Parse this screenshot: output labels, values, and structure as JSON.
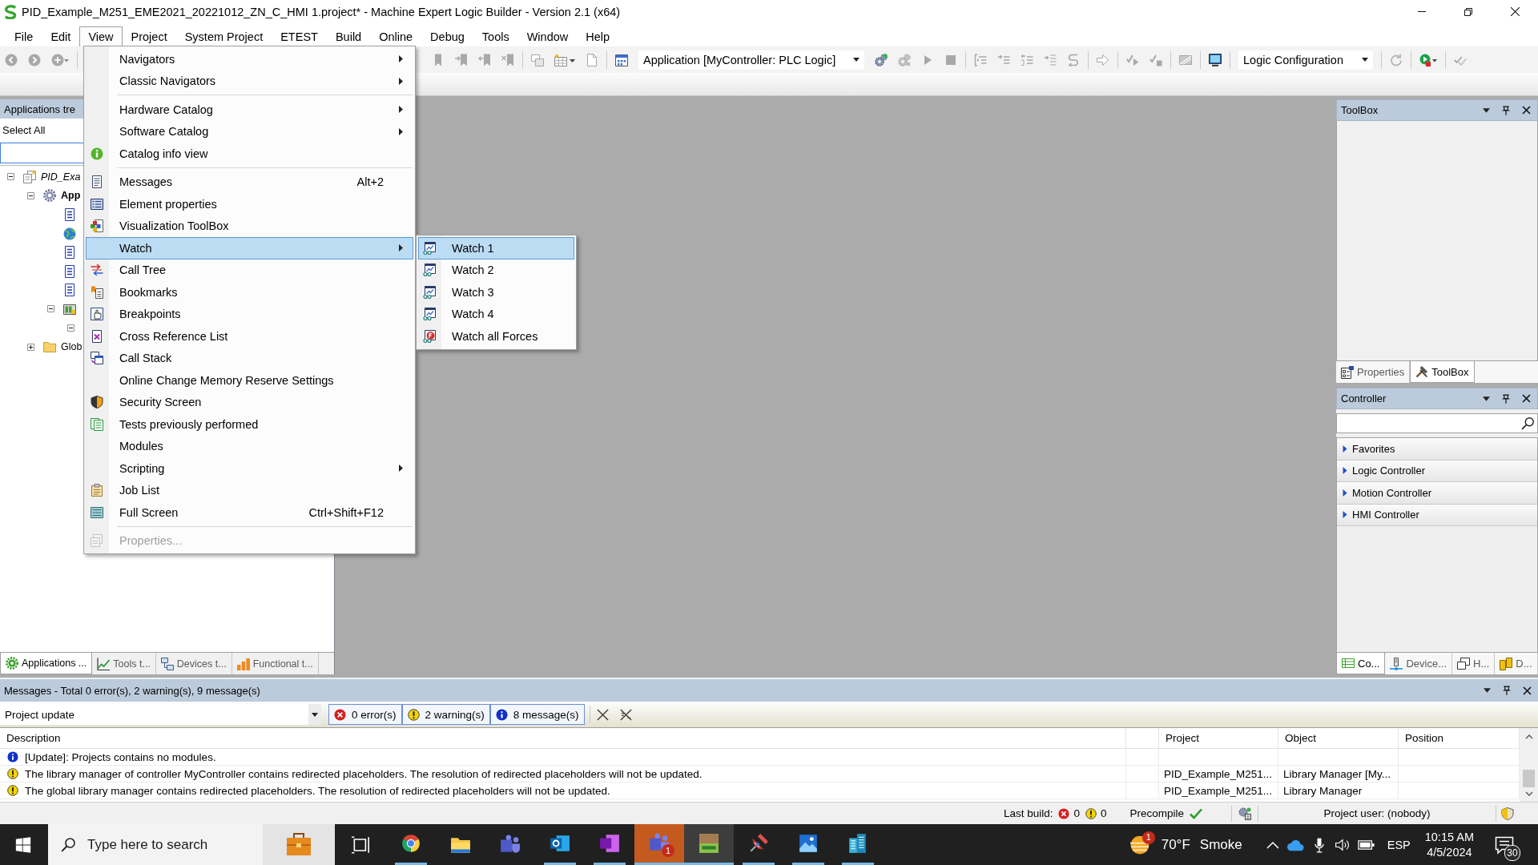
{
  "window": {
    "title": "PID_Example_M251_EME2021_20221012_ZN_C_HMI 1.project* - Machine Expert Logic Builder - Version 2.1 (x64)"
  },
  "menu_bar": [
    {
      "label": "File",
      "selected": false
    },
    {
      "label": "Edit",
      "selected": false
    },
    {
      "label": "View",
      "selected": true
    },
    {
      "label": "Project",
      "selected": false
    },
    {
      "label": "System Project",
      "selected": false
    },
    {
      "label": "ETEST",
      "selected": false
    },
    {
      "label": "Build",
      "selected": false
    },
    {
      "label": "Online",
      "selected": false
    },
    {
      "label": "Debug",
      "selected": false
    },
    {
      "label": "Tools",
      "selected": false
    },
    {
      "label": "Window",
      "selected": false
    },
    {
      "label": "Help",
      "selected": false
    }
  ],
  "toolbar": {
    "application": "Application [MyController: PLC Logic]",
    "configuration": "Logic Configuration"
  },
  "view_menu": [
    {
      "kind": "command",
      "label": "Navigators",
      "submenu": true,
      "selected": false,
      "disabled": false
    },
    {
      "kind": "command",
      "label": "Classic Navigators",
      "submenu": true,
      "selected": false,
      "disabled": false
    },
    {
      "kind": "separator"
    },
    {
      "kind": "command",
      "label": "Hardware Catalog",
      "submenu": true,
      "selected": false,
      "disabled": false
    },
    {
      "kind": "command",
      "label": "Software Catalog",
      "submenu": true,
      "selected": false,
      "disabled": false
    },
    {
      "kind": "command",
      "label": "Catalog info view",
      "submenu": false,
      "selected": false,
      "disabled": false
    },
    {
      "kind": "separator"
    },
    {
      "kind": "command",
      "label": "Messages",
      "shortcut": "Alt+2",
      "submenu": false,
      "selected": false,
      "disabled": false
    },
    {
      "kind": "command",
      "label": "Element properties",
      "submenu": false,
      "selected": false,
      "disabled": false
    },
    {
      "kind": "command",
      "label": "Visualization ToolBox",
      "submenu": false,
      "selected": false,
      "disabled": false
    },
    {
      "kind": "command",
      "label": "Watch",
      "submenu": true,
      "selected": true,
      "disabled": false
    },
    {
      "kind": "command",
      "label": "Call Tree",
      "submenu": false,
      "selected": false,
      "disabled": false
    },
    {
      "kind": "command",
      "label": "Bookmarks",
      "submenu": false,
      "selected": false,
      "disabled": false
    },
    {
      "kind": "command",
      "label": "Breakpoints",
      "submenu": false,
      "selected": false,
      "disabled": false
    },
    {
      "kind": "command",
      "label": "Cross Reference List",
      "submenu": false,
      "selected": false,
      "disabled": false
    },
    {
      "kind": "command",
      "label": "Call Stack",
      "submenu": false,
      "selected": false,
      "disabled": false
    },
    {
      "kind": "command",
      "label": "Online Change Memory Reserve Settings",
      "submenu": false,
      "selected": false,
      "disabled": false
    },
    {
      "kind": "command",
      "label": "Security Screen",
      "submenu": false,
      "selected": false,
      "disabled": false
    },
    {
      "kind": "command",
      "label": "Tests previously performed",
      "submenu": false,
      "selected": false,
      "disabled": false
    },
    {
      "kind": "command",
      "label": "Modules",
      "submenu": false,
      "selected": false,
      "disabled": false
    },
    {
      "kind": "command",
      "label": "Scripting",
      "submenu": true,
      "selected": false,
      "disabled": false
    },
    {
      "kind": "command",
      "label": "Job List",
      "submenu": false,
      "selected": false,
      "disabled": false
    },
    {
      "kind": "command",
      "label": "Full Screen",
      "shortcut": "Ctrl+Shift+F12",
      "submenu": false,
      "selected": false,
      "disabled": false
    },
    {
      "kind": "separator"
    },
    {
      "kind": "command",
      "label": "Properties...",
      "submenu": false,
      "selected": false,
      "disabled": true
    }
  ],
  "watch_submenu": [
    {
      "label": "Watch 1",
      "selected": true
    },
    {
      "label": "Watch 2",
      "selected": false
    },
    {
      "label": "Watch 3",
      "selected": false
    },
    {
      "label": "Watch 4",
      "selected": false
    },
    {
      "label": "Watch all Forces",
      "selected": false
    }
  ],
  "applications_panel": {
    "title": "Applications tre",
    "select_all": "Select All",
    "tree": [
      {
        "kind": "project",
        "label": "PID_Exa",
        "expanded": true,
        "children": [
          {
            "kind": "application",
            "label": "App",
            "expanded": true,
            "children": [
              {
                "kind": "document"
              },
              {
                "kind": "globe"
              },
              {
                "kind": "document"
              },
              {
                "kind": "document"
              },
              {
                "kind": "document"
              },
              {
                "kind": "device",
                "expanded": true,
                "children": [
                  {
                    "expanded": true
                  }
                ]
              }
            ]
          },
          {
            "kind": "folder",
            "label": "Glob",
            "expanded": false
          }
        ]
      }
    ],
    "tabs": [
      {
        "label": "Applications ...",
        "selected": true
      },
      {
        "label": "Tools t...",
        "selected": false
      },
      {
        "label": "Devices t...",
        "selected": false
      },
      {
        "label": "Functional t...",
        "selected": false
      }
    ]
  },
  "toolbox_panel": {
    "title": "ToolBox",
    "tabs": [
      {
        "label": "Properties",
        "selected": false
      },
      {
        "label": "ToolBox",
        "selected": true
      }
    ]
  },
  "controller_panel": {
    "title": "Controller",
    "categories": [
      {
        "label": "Favorites",
        "expanded": false
      },
      {
        "label": "Logic Controller",
        "expanded": false
      },
      {
        "label": "Motion Controller",
        "expanded": false
      },
      {
        "label": "HMI Controller",
        "expanded": false
      }
    ],
    "tabs": [
      {
        "label": "Co...",
        "selected": true
      },
      {
        "label": "Device...",
        "selected": false
      },
      {
        "label": "H...",
        "selected": false
      },
      {
        "label": "D...",
        "selected": false
      }
    ]
  },
  "messages_panel": {
    "title": "Messages - Total 0 error(s), 2 warning(s), 9 message(s)",
    "source": "Project update",
    "filters": [
      {
        "kind": "error",
        "label": "0 error(s)",
        "selected": true
      },
      {
        "kind": "warning",
        "label": "2 warning(s)",
        "selected": true
      },
      {
        "kind": "info",
        "label": "8 message(s)",
        "selected": true
      }
    ],
    "columns": {
      "description": "Description",
      "project": "Project",
      "object": "Object",
      "position": "Position"
    },
    "rows": [
      {
        "kind": "info",
        "description": "[Update]: Projects contains no modules."
      },
      {
        "kind": "warning",
        "description": "The library manager of controller MyController contains redirected placeholders. The resolution of redirected placeholders will not be updated.",
        "project": "PID_Example_M251...",
        "object": "Library Manager [My..."
      },
      {
        "kind": "warning",
        "description": "The global library manager contains redirected placeholders. The resolution of redirected placeholders will not be updated.",
        "project": "PID_Example_M251...",
        "object": "Library Manager"
      }
    ]
  },
  "status_bar": {
    "last_build": "Last build:",
    "errors": "0",
    "warnings": "0",
    "precompile": "Precompile",
    "project_user": "Project user: (nobody)"
  },
  "taskbar": {
    "search": {
      "placeholder": "Type here to search"
    },
    "apps": [
      {
        "kind": "task-view",
        "running": false,
        "selected": false,
        "attention": false
      },
      {
        "kind": "browser",
        "running": true,
        "selected": false,
        "attention": false
      },
      {
        "kind": "folder",
        "running": false,
        "selected": false,
        "attention": false
      },
      {
        "kind": "chat",
        "running": false,
        "selected": false,
        "attention": false
      },
      {
        "kind": "mail",
        "running": true,
        "selected": false,
        "attention": false
      },
      {
        "kind": "notebook",
        "running": true,
        "selected": false,
        "attention": false
      },
      {
        "kind": "chat",
        "running": true,
        "selected": false,
        "attention": true,
        "badge": "1"
      },
      {
        "kind": "app-tile",
        "running": true,
        "selected": true,
        "attention": false
      },
      {
        "kind": "satellite",
        "running": true,
        "selected": false,
        "attention": false
      },
      {
        "kind": "picture",
        "running": true,
        "selected": false,
        "attention": false
      },
      {
        "kind": "buildings",
        "running": true,
        "selected": false,
        "attention": false
      }
    ],
    "weather": {
      "badge": "1",
      "temperature": "70°F",
      "condition": "Smoke"
    },
    "language": "ESP",
    "time": "10:15 AM",
    "date": "4/5/2024",
    "notifications": "30"
  }
}
